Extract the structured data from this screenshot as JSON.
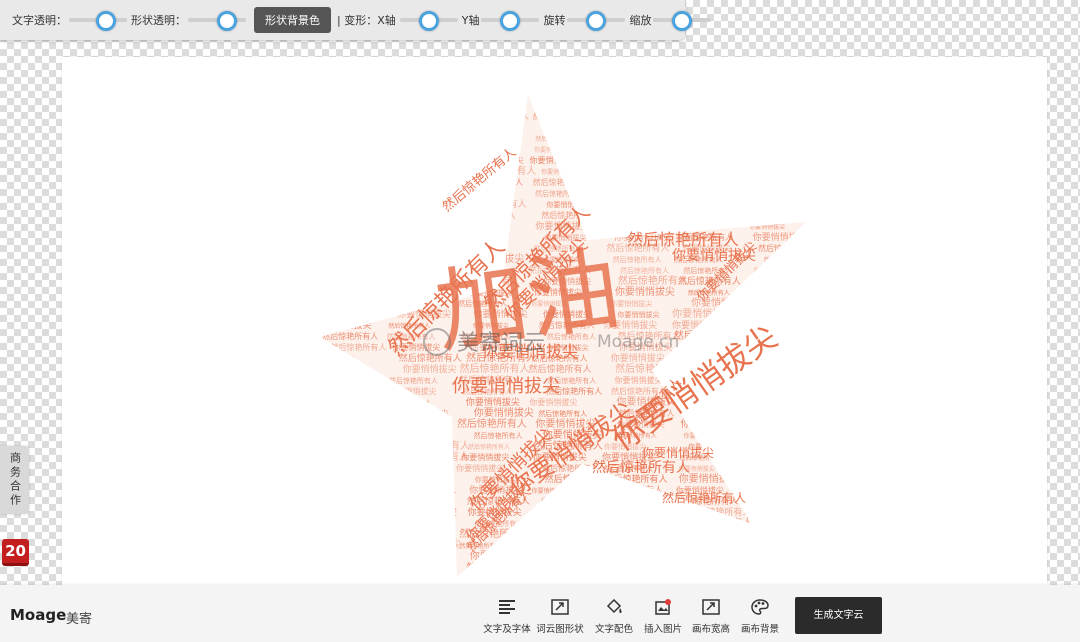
{
  "toolbar": {
    "text_opacity_label": "文字透明：",
    "text_opacity_value": 0.7,
    "shape_opacity_label": "形状透明：",
    "shape_opacity_value": 0.75,
    "shape_bg_button": "形状背景色",
    "transform_label": "| 变形：X轴",
    "x_axis_value": 0.5,
    "y_axis_label": "Y轴",
    "y_axis_value": 0.5,
    "rotate_label": "旋转",
    "rotate_value": 0.5,
    "scale_label": "缩放",
    "scale_value": 0.5,
    "accent_color": "#4aa3df"
  },
  "side": {
    "business_label": "商务合作",
    "badge_label": "20"
  },
  "canvas": {
    "big_word": "加油",
    "phrases": [
      "然后惊艳所有人",
      "你要悄悄拔尖"
    ],
    "watermark_brand": "美寄词云",
    "watermark_domain": "Moage.cn",
    "word_color": "#e8734f"
  },
  "bottom": {
    "logo_en": "Moage",
    "logo_cn": "美寄",
    "tools": [
      {
        "label": "文字及字体",
        "icon": "text-align-icon"
      },
      {
        "label": "词云图形状",
        "icon": "shape-icon"
      },
      {
        "label": "文字配色",
        "icon": "paint-bucket-icon"
      },
      {
        "label": "插入图片",
        "icon": "image-insert-icon"
      },
      {
        "label": "画布宽高",
        "icon": "resize-icon"
      },
      {
        "label": "画布背景",
        "icon": "palette-icon"
      }
    ],
    "generate_button": "生成文字云"
  }
}
